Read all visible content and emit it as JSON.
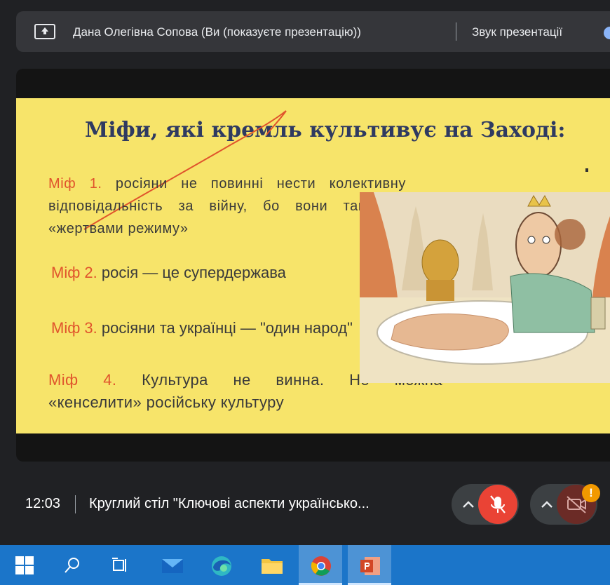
{
  "banner": {
    "title": "Дана Олегівна Сопова (Ви (показуєте презентацію))",
    "audio_label": "Звук презентації"
  },
  "slide": {
    "title": "Міфи, які кремль культивує на Заході:",
    "myths": [
      {
        "num": "Міф 1. ",
        "text": "росіяни не повинні нести колективну відповідальність за війну, бо вони також є «жертвами режиму»"
      },
      {
        "num": "Міф 2. ",
        "text": "росія — це супердержава"
      },
      {
        "num": "Міф 3. ",
        "text": "росіяни та українці — \"один народ\""
      },
      {
        "num_a": "Міф",
        "num_b": "4.",
        "w1": "Культура",
        "w2": "не",
        "w3": "винна.",
        "w4": "Не",
        "w5": "можна",
        "line2": "«кенселити» російську культуру"
      }
    ]
  },
  "meeting": {
    "time": "12:03",
    "title": "Круглий стіл \"Ключові аспекти українсько...",
    "alert_badge": "!"
  },
  "taskbar": {
    "items": [
      "windows-start",
      "search",
      "task-view",
      "mail",
      "edge",
      "file-explorer",
      "chrome",
      "powerpoint"
    ]
  },
  "colors": {
    "slide_bg": "#f7e46a",
    "title_color": "#2f3a61",
    "myth_number": "#e0542c",
    "mic_off": "#ea4335",
    "taskbar": "#1b75c9"
  }
}
